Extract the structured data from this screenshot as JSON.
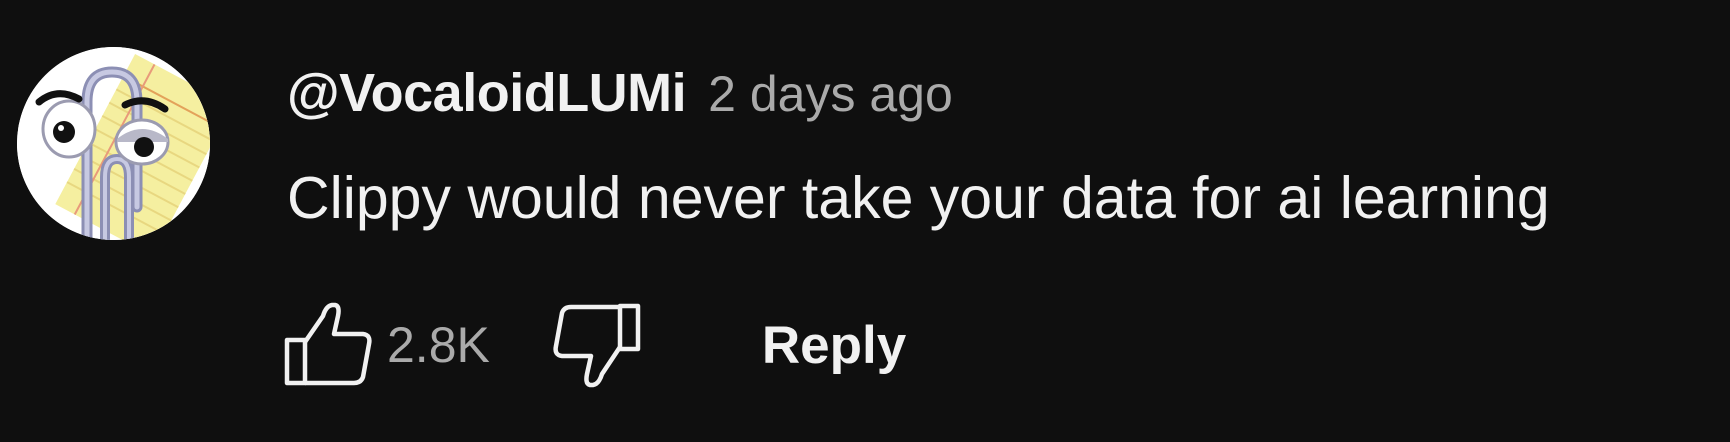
{
  "comment": {
    "author": "@VocaloidLUMi",
    "timestamp": "2 days ago",
    "text": "Clippy would never take your data for ai learning",
    "avatar_icon": "clippy-avatar",
    "like_icon": "thumbs-up-icon",
    "like_count": "2.8K",
    "dislike_icon": "thumbs-down-icon",
    "reply_label": "Reply"
  },
  "colors": {
    "background": "#0f0f0f",
    "primary_text": "#f1f1f1",
    "secondary_text": "#aaaaaa",
    "avatar_paper": "#f5efa0",
    "avatar_clip": "#a6a8c8"
  }
}
